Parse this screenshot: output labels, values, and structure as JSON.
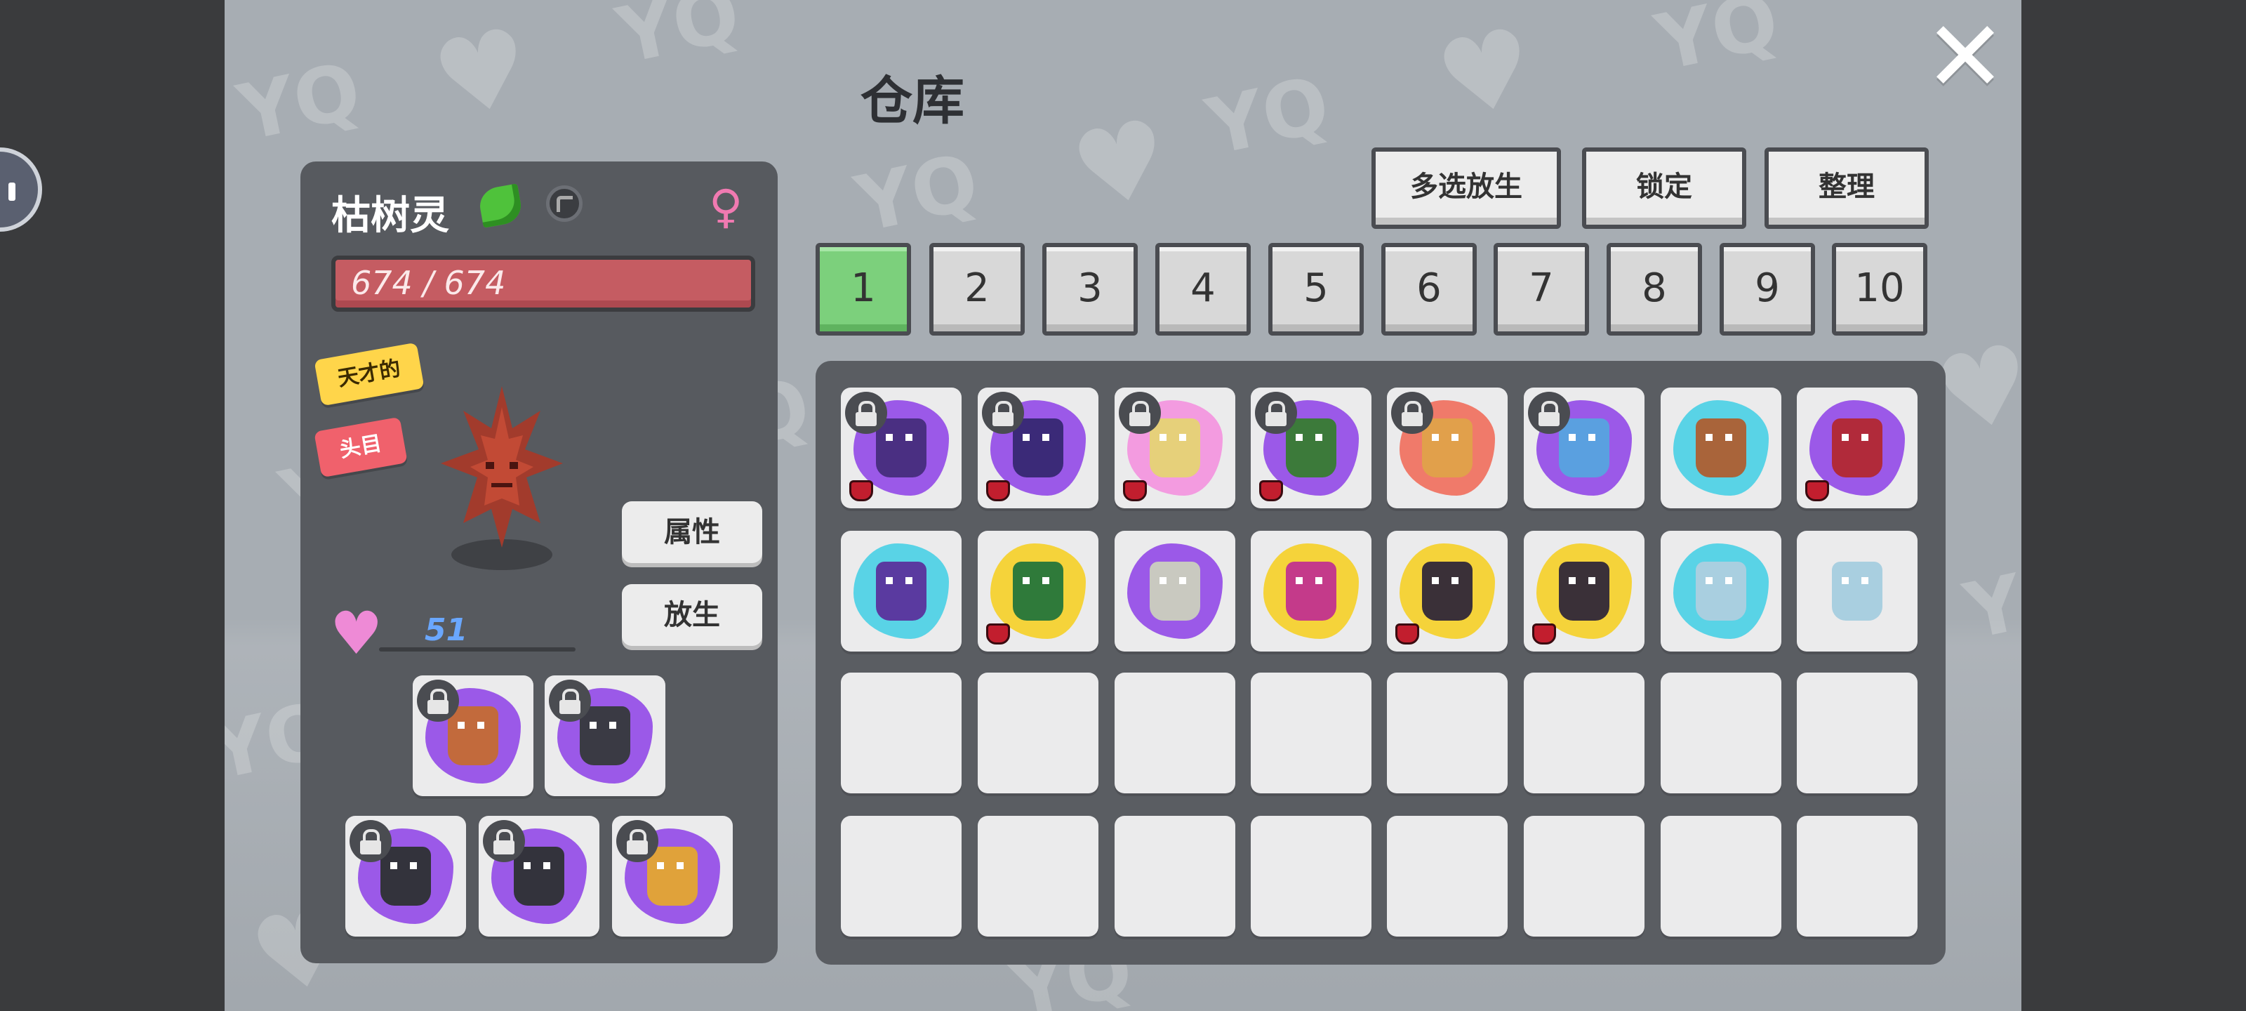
{
  "title": "仓库",
  "close_icon": "close-icon",
  "toolbar": {
    "multi_release_label": "多选放生",
    "lock_label": "锁定",
    "sort_label": "整理"
  },
  "tabs": [
    {
      "label": "1",
      "active": true
    },
    {
      "label": "2",
      "active": false
    },
    {
      "label": "3",
      "active": false
    },
    {
      "label": "4",
      "active": false
    },
    {
      "label": "5",
      "active": false
    },
    {
      "label": "6",
      "active": false
    },
    {
      "label": "7",
      "active": false
    },
    {
      "label": "8",
      "active": false
    },
    {
      "label": "9",
      "active": false
    },
    {
      "label": "10",
      "active": false
    }
  ],
  "pet": {
    "name": "枯树灵",
    "element_icon": "leaf-icon",
    "gender_icon": "female-icon",
    "hp_text": "674 / 674",
    "hp_fraction": 1.0,
    "tags": [
      "天才的",
      "头目"
    ],
    "affection": "51",
    "attributes_label": "属性",
    "release_label": "放生"
  },
  "colors": {
    "active_tab": "#7cd07c",
    "hp_bar": "#c55c62",
    "purple_aura": "#9b59e8",
    "yellow_aura": "#f5d33a",
    "cyan_aura": "#59d3e6",
    "pink_aura": "#f39be0",
    "red_aura": "#f07a6a"
  },
  "team": [
    {
      "icon": "pet-sprite",
      "locked": true,
      "aura": "#9b59e8",
      "body": "#c26a3c"
    },
    {
      "icon": "pet-sprite",
      "locked": true,
      "aura": "#9b59e8",
      "body": "#3a3a44"
    },
    {
      "icon": "pet-sprite",
      "locked": true,
      "aura": "#9b59e8",
      "body": "#33333c"
    },
    {
      "icon": "pet-sprite",
      "locked": true,
      "aura": "#9b59e8",
      "body": "#33333c"
    },
    {
      "icon": "pet-sprite",
      "locked": true,
      "aura": "#9b59e8",
      "body": "#e0a23a"
    }
  ],
  "storage": [
    {
      "locked": true,
      "aura": "#9b59e8",
      "body": "#4a2f82",
      "potion": true
    },
    {
      "locked": true,
      "aura": "#9b59e8",
      "body": "#3b2a78",
      "potion": true
    },
    {
      "locked": true,
      "aura": "#f39be0",
      "body": "#e6d07a",
      "potion": true
    },
    {
      "locked": true,
      "aura": "#9b59e8",
      "body": "#3c7a3a",
      "potion": true
    },
    {
      "locked": true,
      "aura": "#f07a6a",
      "body": "#e1a04b",
      "potion": false
    },
    {
      "locked": true,
      "aura": "#9b59e8",
      "body": "#5aa0e0",
      "potion": false
    },
    {
      "locked": false,
      "aura": "#59d3e6",
      "body": "#a9643a",
      "potion": false
    },
    {
      "locked": false,
      "aura": "#9b59e8",
      "body": "#b12a3a",
      "potion": true
    },
    {
      "locked": false,
      "aura": "#59d3e6",
      "body": "#5a3aa0",
      "potion": false
    },
    {
      "locked": false,
      "aura": "#f5d33a",
      "body": "#2f7a3a",
      "potion": true
    },
    {
      "locked": false,
      "aura": "#9b59e8",
      "body": "#c9c9c0",
      "potion": false
    },
    {
      "locked": false,
      "aura": "#f5d33a",
      "body": "#c43a8a",
      "potion": false
    },
    {
      "locked": false,
      "aura": "#f5d33a",
      "body": "#3a3038",
      "potion": true
    },
    {
      "locked": false,
      "aura": "#f5d33a",
      "body": "#3a3038",
      "potion": true
    },
    {
      "locked": false,
      "aura": "#59d3e6",
      "body": "#a9cfe0",
      "potion": false
    },
    {
      "locked": false,
      "aura": "",
      "body": "#a9cfe0",
      "potion": false
    },
    {},
    {},
    {},
    {},
    {},
    {},
    {},
    {},
    {},
    {},
    {},
    {},
    {},
    {},
    {},
    {}
  ]
}
